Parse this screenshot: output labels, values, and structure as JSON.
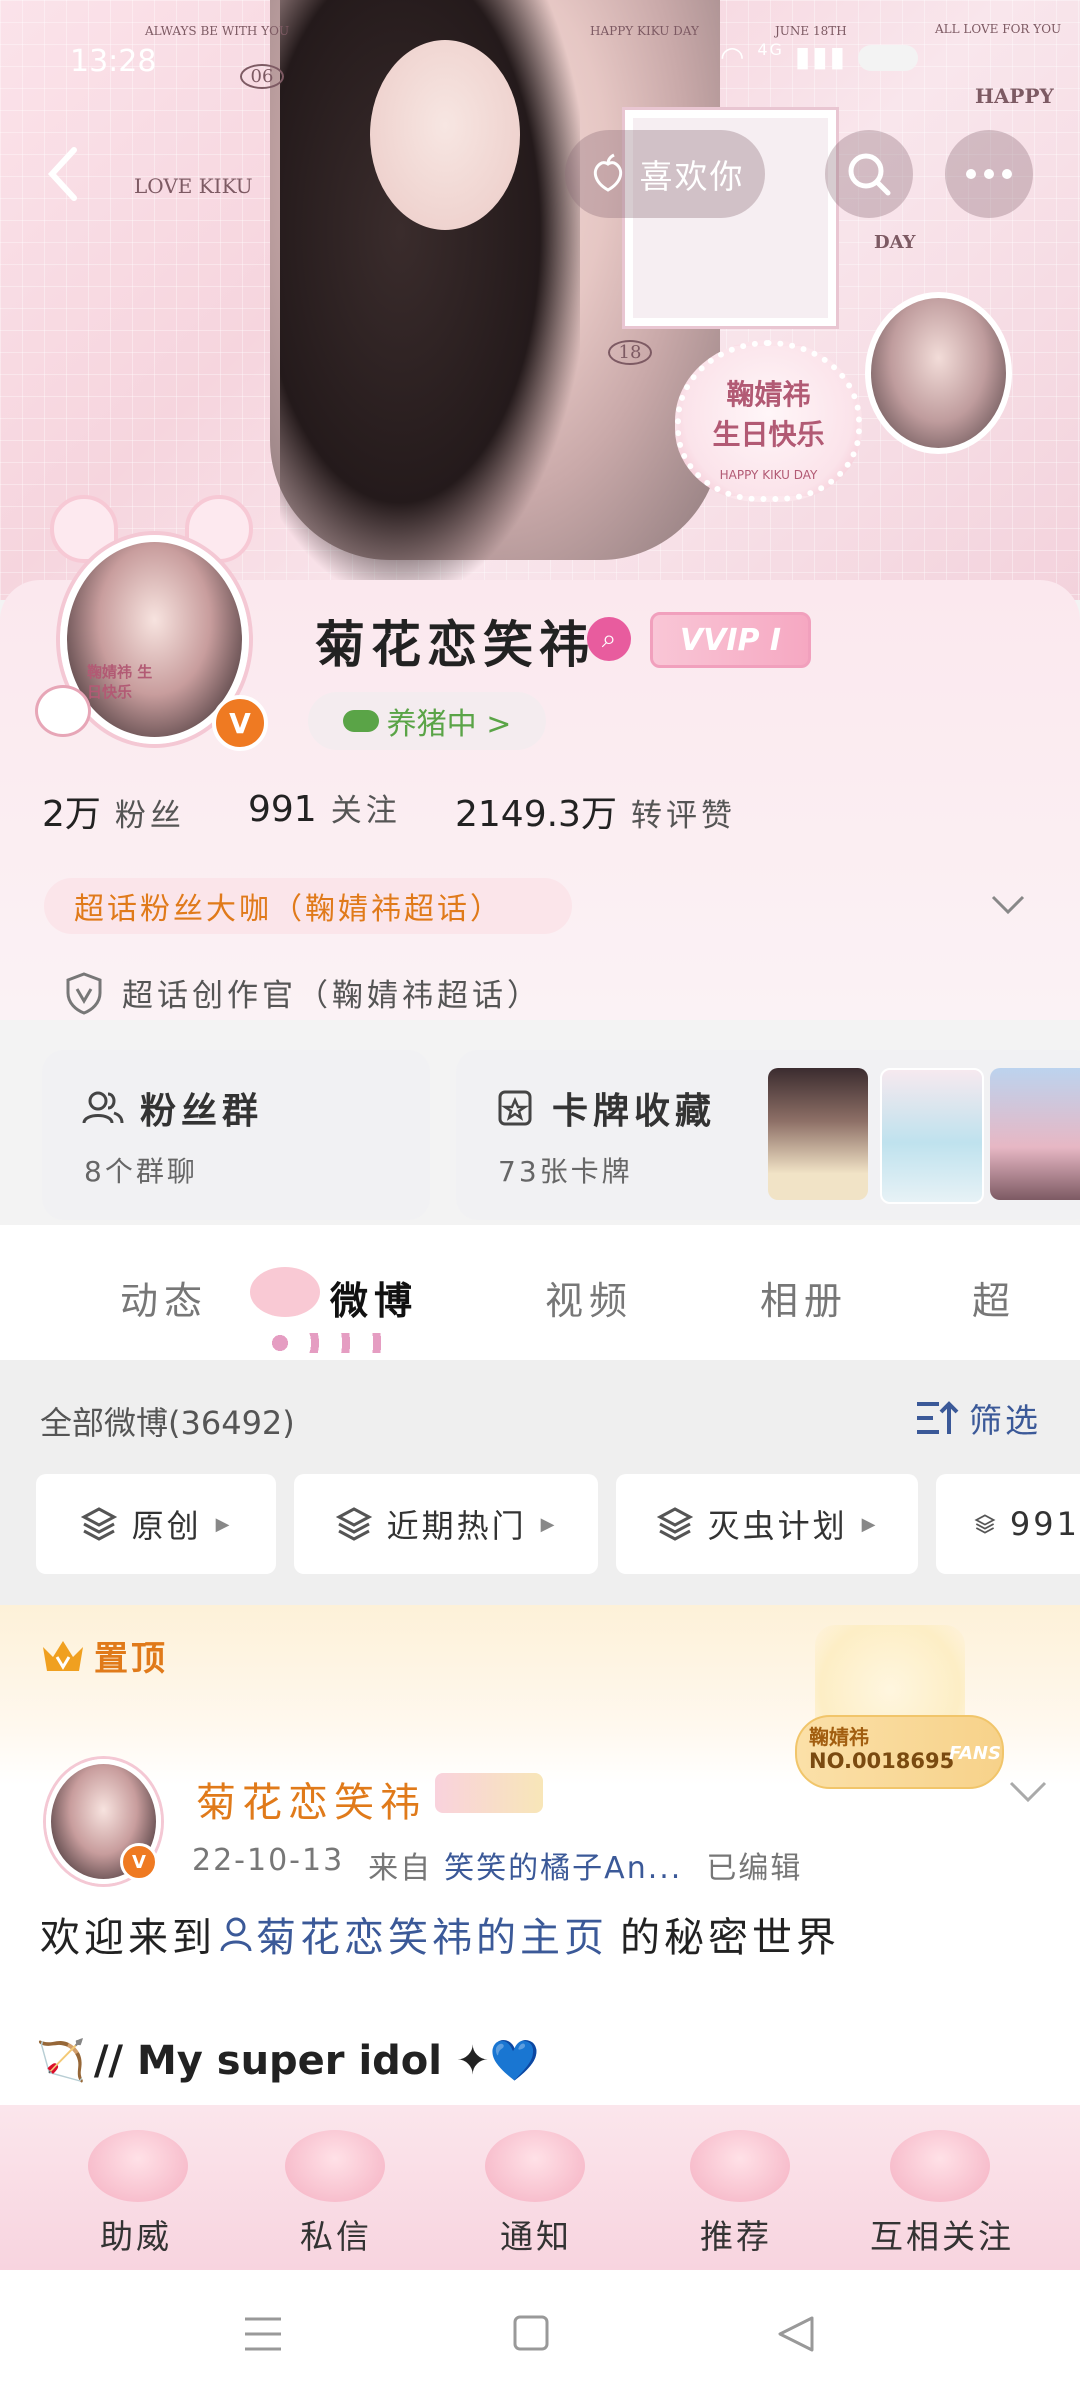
{
  "status_bar": {
    "time": "13:28",
    "network": "4G"
  },
  "banner": {
    "deco_texts": [
      "ALWAYS BE WITH YOU",
      "HAPPY KIKU DAY",
      "JUNE 18TH",
      "ALL LOVE FOR YOU",
      "HAPPY",
      "LOVE KIKU",
      "DAY",
      "06",
      "18"
    ],
    "birthday_card": {
      "line1": "鞠婧祎",
      "line2": "生日快乐",
      "sub": "HAPPY KIKU DAY"
    },
    "like_button": "喜欢你"
  },
  "profile": {
    "name": "菊花恋笑祎",
    "vip_label": "VVIP I",
    "vip_badge": "V",
    "avatar_text": "鞠婧祎 生日快乐",
    "pig_status": "养猪中 >",
    "stats": [
      {
        "value": "2万",
        "label": "粉丝"
      },
      {
        "value": "991",
        "label": "关注"
      },
      {
        "value": "2149.3万",
        "label": "转评赞"
      }
    ],
    "tag_super": "超话粉丝大咖（鞠婧祎超话）",
    "tag_creator": "超话创作官（鞠婧祎超话）"
  },
  "cards": {
    "fans_group": {
      "title": "粉丝群",
      "sub": "8个群聊"
    },
    "card_collection": {
      "title": "卡牌收藏",
      "sub": "73张卡牌"
    }
  },
  "tabs": [
    "动态",
    "微博",
    "视频",
    "相册",
    "超"
  ],
  "filter": {
    "all_label": "全部微博(36492)",
    "filter_button": "筛选",
    "chips": [
      "原创",
      "近期热门",
      "灭虫计划",
      "991"
    ]
  },
  "pinned": {
    "header": "置顶",
    "fan_badge": {
      "name": "鞠婧祎",
      "number": "NO.0018695",
      "tag": "FANS"
    },
    "post": {
      "author": "菊花恋笑祎",
      "date": "22-10-13",
      "from_label": "来自",
      "source": "笑笑的橘子An...",
      "edited": "已编辑",
      "text_prefix": "欢迎来到",
      "text_link": "菊花恋笑祎的主页",
      "text_suffix": "的秘密世界",
      "second_line": "// My super idol  ✦💙"
    }
  },
  "bottom_nav": [
    "助威",
    "私信",
    "通知",
    "推荐",
    "互相关注"
  ],
  "colors": {
    "accent_orange": "#e07a1a",
    "link_blue": "#3b5998",
    "pink": "#e85c9e",
    "vip_orange": "#ef7a22"
  }
}
